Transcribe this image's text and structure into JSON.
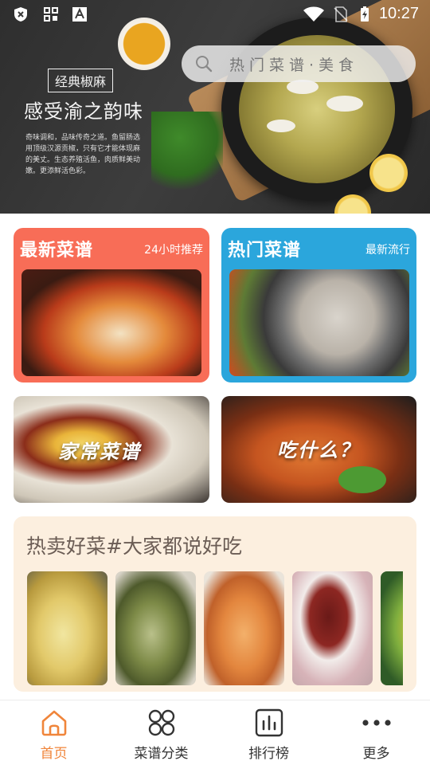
{
  "status_bar": {
    "time": "10:27",
    "icons": [
      "shield-x-icon",
      "grid-icon",
      "app-badge-icon",
      "wifi-icon",
      "no-sim-icon",
      "battery-charging-icon"
    ]
  },
  "hero": {
    "badge": "经典椒麻",
    "slogan": "感受渝之韵味",
    "desc": "奇味调和，品味传奇之道。鱼留肠选用顶级汉源贡椒，只有它才能体现麻的美丈。生态养殖活鱼，肉质鲜美动嫩。更添鲜活色彩。"
  },
  "search": {
    "placeholder": "热门菜谱·美食",
    "icon": "search-icon"
  },
  "cards": [
    {
      "title": "最新菜谱",
      "subtitle": "24小时推荐",
      "color": "#f86d57"
    },
    {
      "title": "热门菜谱",
      "subtitle": "最新流行",
      "color": "#2ba6dc"
    }
  ],
  "tiles": [
    {
      "label": "家常菜谱"
    },
    {
      "label": "吃什么？"
    }
  ],
  "hot_section": {
    "title": "热卖好菜#大家都说好吃",
    "background": "#fcefdf"
  },
  "nav": {
    "accent": "#f0853a",
    "items": [
      {
        "label": "首页",
        "icon": "home-icon",
        "active": true
      },
      {
        "label": "菜谱分类",
        "icon": "category-grid-icon",
        "active": false
      },
      {
        "label": "排行榜",
        "icon": "ranking-chart-icon",
        "active": false
      },
      {
        "label": "更多",
        "icon": "more-dots-icon",
        "active": false
      }
    ]
  }
}
